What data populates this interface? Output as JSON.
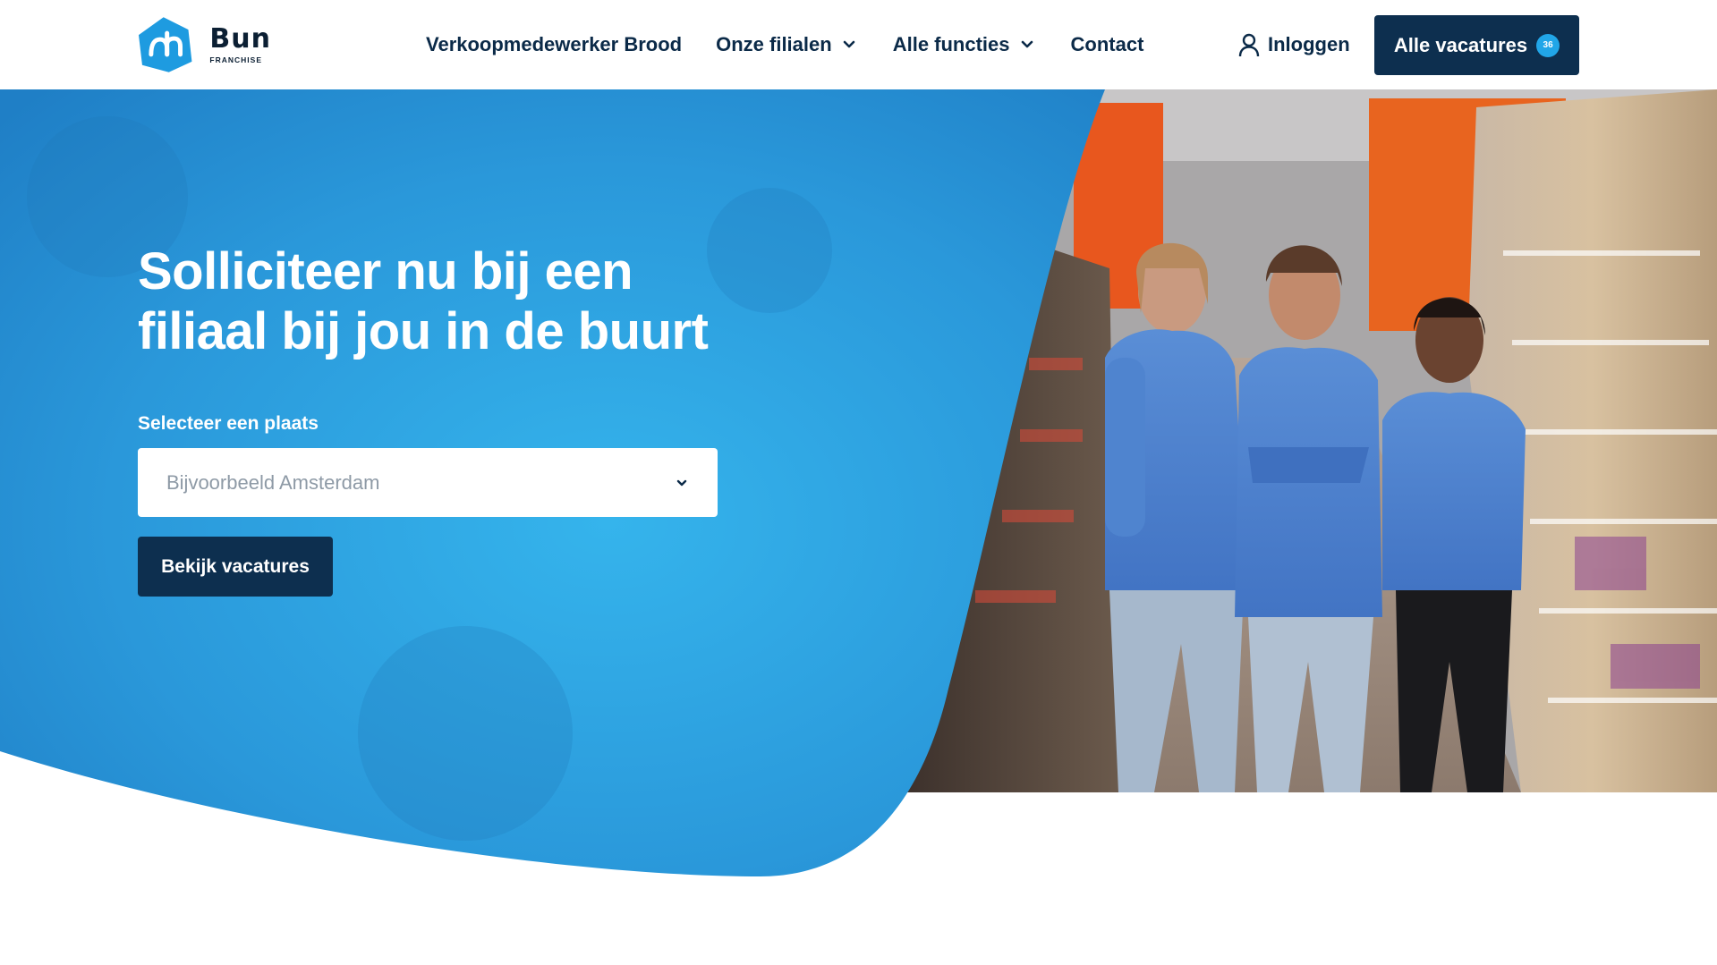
{
  "header": {
    "logo": {
      "name": "Bun",
      "subtitle": "FRANCHISE",
      "mark": "ah-logo-icon"
    },
    "nav": [
      {
        "label": "Verkoopmedewerker Brood",
        "has_dropdown": false
      },
      {
        "label": "Onze filialen",
        "has_dropdown": true,
        "icon": "chevron-down-icon"
      },
      {
        "label": "Alle functies",
        "has_dropdown": true,
        "icon": "chevron-down-icon"
      },
      {
        "label": "Contact",
        "has_dropdown": false
      }
    ],
    "login": {
      "label": "Inloggen",
      "icon": "user-icon"
    },
    "cta": {
      "label": "Alle vacatures",
      "count": "36"
    }
  },
  "hero": {
    "title": "Solliciteer nu bij een filiaal bij jou in de buurt",
    "select": {
      "label": "Selecteer een plaats",
      "placeholder": "Bijvoorbeeld Amsterdam",
      "icon": "chevron-down-icon"
    },
    "button": "Bekijk vacatures",
    "photo": "three-employees-in-supermarket-aisle-photo"
  },
  "colors": {
    "navy": "#0d2f4f",
    "hero_blue": "#2a95d8",
    "badge_blue": "#21a6e8",
    "text_dark": "#0b2a48"
  }
}
